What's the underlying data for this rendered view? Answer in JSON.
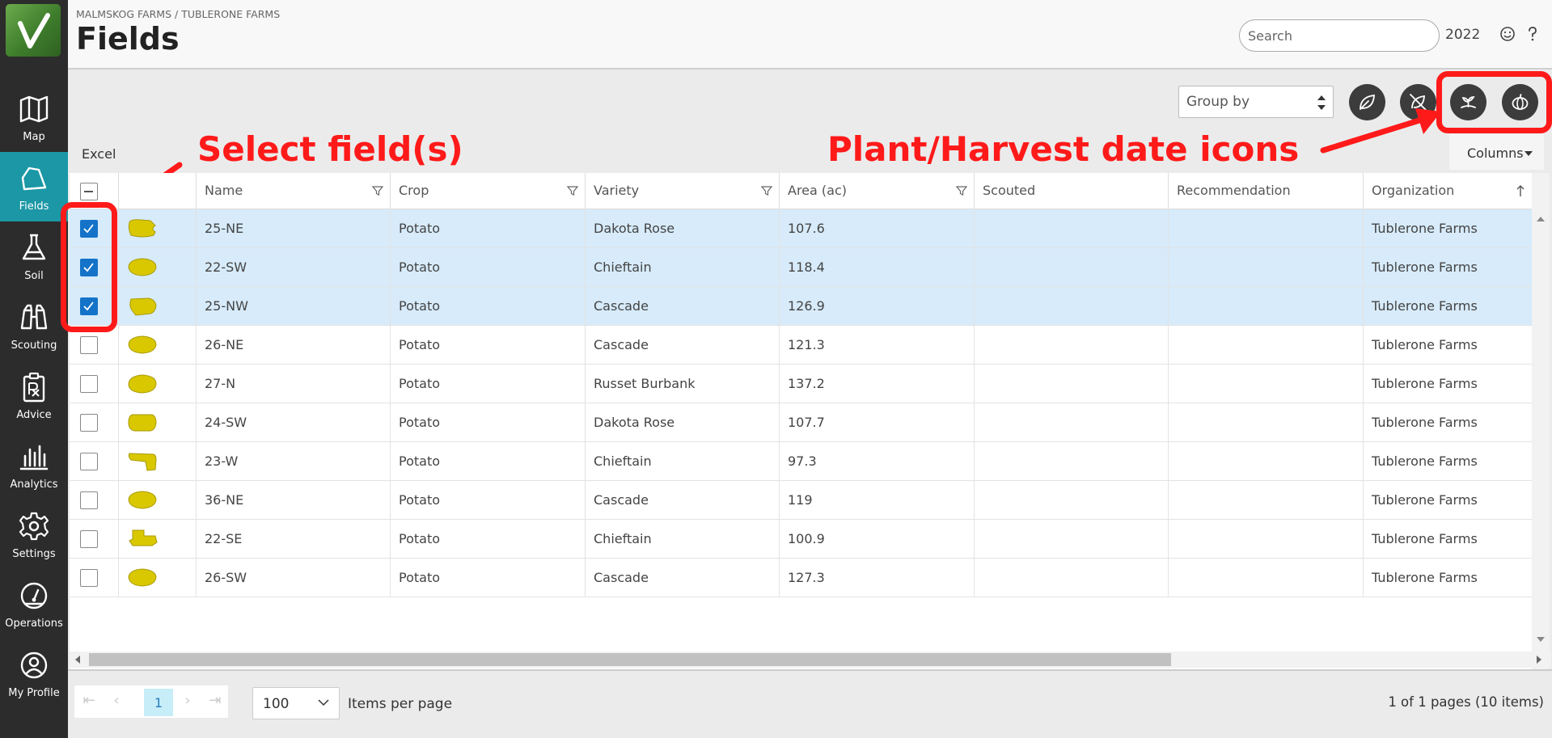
{
  "sidebar": {
    "items": [
      {
        "label": "Map",
        "icon": "map-icon"
      },
      {
        "label": "Fields",
        "icon": "fields-icon",
        "active": true
      },
      {
        "label": "Soil",
        "icon": "flask-icon"
      },
      {
        "label": "Scouting",
        "icon": "binoculars-icon"
      },
      {
        "label": "Advice",
        "icon": "prescription-icon"
      },
      {
        "label": "Analytics",
        "icon": "bar-chart-icon"
      },
      {
        "label": "Settings",
        "icon": "gear-icon"
      },
      {
        "label": "Operations",
        "icon": "gauge-icon"
      },
      {
        "label": "My Profile",
        "icon": "user-icon"
      }
    ]
  },
  "header": {
    "breadcrumb": "MALMSKOG FARMS / TUBLERONE FARMS",
    "title": "Fields",
    "search_placeholder": "Search",
    "year": "2022"
  },
  "toolbar": {
    "group_by": "Group by",
    "excel": "Excel",
    "columns": "Columns"
  },
  "annotations": {
    "select_fields": "Select field(s)",
    "plant_harvest": "Plant/Harvest date icons"
  },
  "grid": {
    "columns": [
      "Name",
      "Crop",
      "Variety",
      "Area (ac)",
      "Scouted",
      "Recommendation",
      "Organization"
    ],
    "rows": [
      {
        "name": "25-NE",
        "crop": "Potato",
        "variety": "Dakota Rose",
        "area": "107.6",
        "scouted": "",
        "recommendation": "",
        "organization": "Tublerone Farms",
        "selected": true
      },
      {
        "name": "22-SW",
        "crop": "Potato",
        "variety": "Chieftain",
        "area": "118.4",
        "scouted": "",
        "recommendation": "",
        "organization": "Tublerone Farms",
        "selected": true
      },
      {
        "name": "25-NW",
        "crop": "Potato",
        "variety": "Cascade",
        "area": "126.9",
        "scouted": "",
        "recommendation": "",
        "organization": "Tublerone Farms",
        "selected": true
      },
      {
        "name": "26-NE",
        "crop": "Potato",
        "variety": "Cascade",
        "area": "121.3",
        "scouted": "",
        "recommendation": "",
        "organization": "Tublerone Farms",
        "selected": false
      },
      {
        "name": "27-N",
        "crop": "Potato",
        "variety": "Russet Burbank",
        "area": "137.2",
        "scouted": "",
        "recommendation": "",
        "organization": "Tublerone Farms",
        "selected": false
      },
      {
        "name": "24-SW",
        "crop": "Potato",
        "variety": "Dakota Rose",
        "area": "107.7",
        "scouted": "",
        "recommendation": "",
        "organization": "Tublerone Farms",
        "selected": false
      },
      {
        "name": "23-W",
        "crop": "Potato",
        "variety": "Chieftain",
        "area": "97.3",
        "scouted": "",
        "recommendation": "",
        "organization": "Tublerone Farms",
        "selected": false
      },
      {
        "name": "36-NE",
        "crop": "Potato",
        "variety": "Cascade",
        "area": "119",
        "scouted": "",
        "recommendation": "",
        "organization": "Tublerone Farms",
        "selected": false
      },
      {
        "name": "22-SE",
        "crop": "Potato",
        "variety": "Chieftain",
        "area": "100.9",
        "scouted": "",
        "recommendation": "",
        "organization": "Tublerone Farms",
        "selected": false
      },
      {
        "name": "26-SW",
        "crop": "Potato",
        "variety": "Cascade",
        "area": "127.3",
        "scouted": "",
        "recommendation": "",
        "organization": "Tublerone Farms",
        "selected": false
      }
    ]
  },
  "pager": {
    "current_page": "1",
    "per_page": "100",
    "per_page_label": "Items per page",
    "info": "1 of 1 pages (10 items)"
  },
  "colors": {
    "sidebar_bg": "#2c2c2c",
    "active_nav": "#1b97a5",
    "selected_row": "#d7ebfa",
    "checkbox_checked": "#1473c8",
    "annotation_red": "#ff1a1a",
    "field_shape": "#d9c800"
  }
}
